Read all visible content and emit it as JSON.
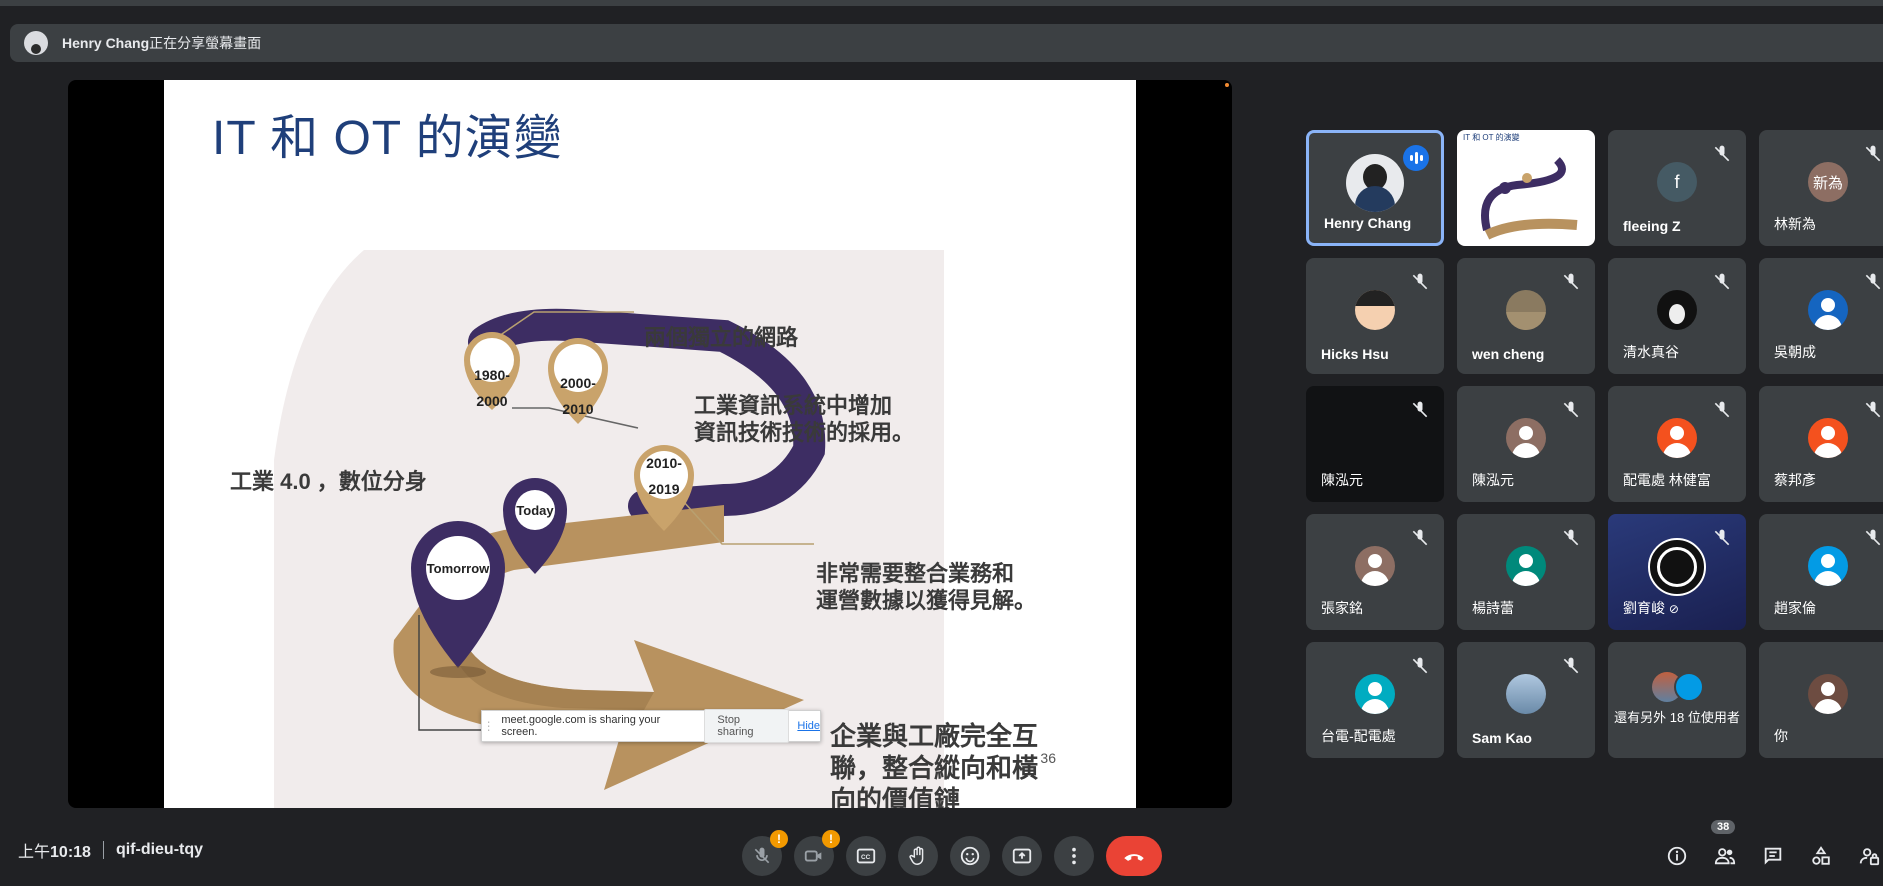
{
  "banner": {
    "presenter": "Henry Chang",
    "suffix": "正在分享螢幕畫面"
  },
  "slide": {
    "title": "IT 和 OT 的演變",
    "labels": {
      "two_networks": "兩個獨立的網路",
      "it_adoption_1": "工業資訊系統中增加",
      "it_adoption_2": "資訊技術技術的採用。",
      "industry40": "工業 4.0 ，數位分身",
      "insight_1": "非常需要整合業務和",
      "insight_2": "運營數據以獲得見解。",
      "future_1": "企業與工廠完全互",
      "future_2": "聯，整合縱向和橫",
      "future_3": "向的價值鏈"
    },
    "pins": {
      "p1_a": "1980-",
      "p1_b": "2000",
      "p2_a": "2000-",
      "p2_b": "2010",
      "p3_a": "2010-",
      "p3_b": "2019",
      "today": "Today",
      "tomorrow": "Tomorrow"
    },
    "page_number": "36"
  },
  "share_popup": {
    "message": "meet.google.com is sharing your screen.",
    "stop": "Stop sharing",
    "hide": "Hide"
  },
  "participants": [
    {
      "name": "Henry Chang",
      "type": "photo"
    },
    {
      "name": "",
      "type": "screen"
    },
    {
      "name": "fleeing Z",
      "initial": "f",
      "color": "#455a64"
    },
    {
      "name": "林新為",
      "initial": "新為",
      "color": "#8d6e63"
    },
    {
      "name": "Hicks Hsu",
      "type": "photo"
    },
    {
      "name": "wen cheng",
      "type": "photo"
    },
    {
      "name": "清水真谷",
      "type": "photo"
    },
    {
      "name": "吳朝成",
      "color": "#1565c0"
    },
    {
      "name": "陳泓元",
      "type": "dark"
    },
    {
      "name": "陳泓元",
      "color": "#8d6e63"
    },
    {
      "name": "配電處 林健富",
      "color": "#f4511e"
    },
    {
      "name": "蔡邦彥",
      "color": "#f4511e"
    },
    {
      "name": "張家銘",
      "color": "#8d6e63"
    },
    {
      "name": "楊詩蕾",
      "color": "#00897b"
    },
    {
      "name": "劉育峻",
      "type": "obs"
    },
    {
      "name": "趙家倫",
      "color": "#039be5"
    },
    {
      "name": "台電-配電處",
      "color": "#00acc1"
    },
    {
      "name": "Sam Kao",
      "type": "photo"
    },
    {
      "name": "還有另外 18 位使用者",
      "type": "others"
    },
    {
      "name": "你",
      "color": "#6d4c41"
    }
  ],
  "footer": {
    "time_prefix": "上午",
    "time": "10:18",
    "meeting_code": "qif-dieu-tqy",
    "participant_count": "38"
  }
}
